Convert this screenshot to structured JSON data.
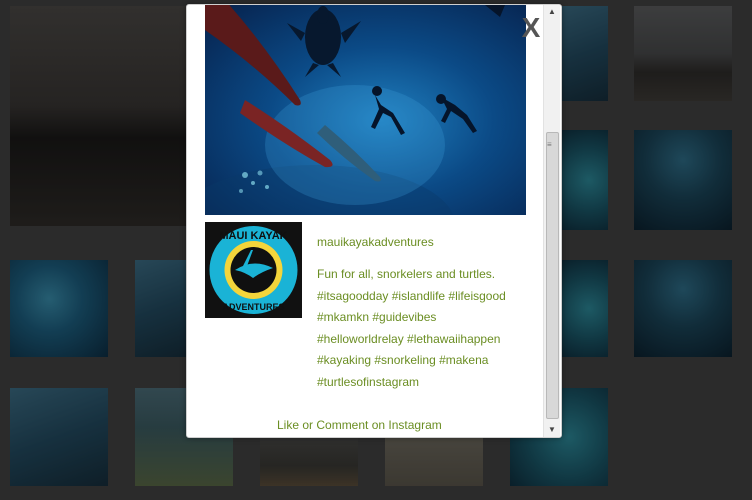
{
  "modal": {
    "close_label": "X",
    "username": "mauikayakadventures",
    "caption": "Fun for all, snorkelers and turtles. #itsagoodday #islandlife #lifeisgood #mkamkn #guidevibes #helloworldrelay #lethawaiihappen #kayaking #snorkeling #makena #turtlesofinstagram",
    "link_label": "Like or Comment on Instagram",
    "avatar_logo_text": "MAUI KAYAK ADVENTURES"
  },
  "scrollbar": {
    "up_arrow": "▲",
    "down_arrow": "▼",
    "position": 0.35
  },
  "colors": {
    "link": "#6b8e23",
    "overlay": "#2b2b2b"
  }
}
